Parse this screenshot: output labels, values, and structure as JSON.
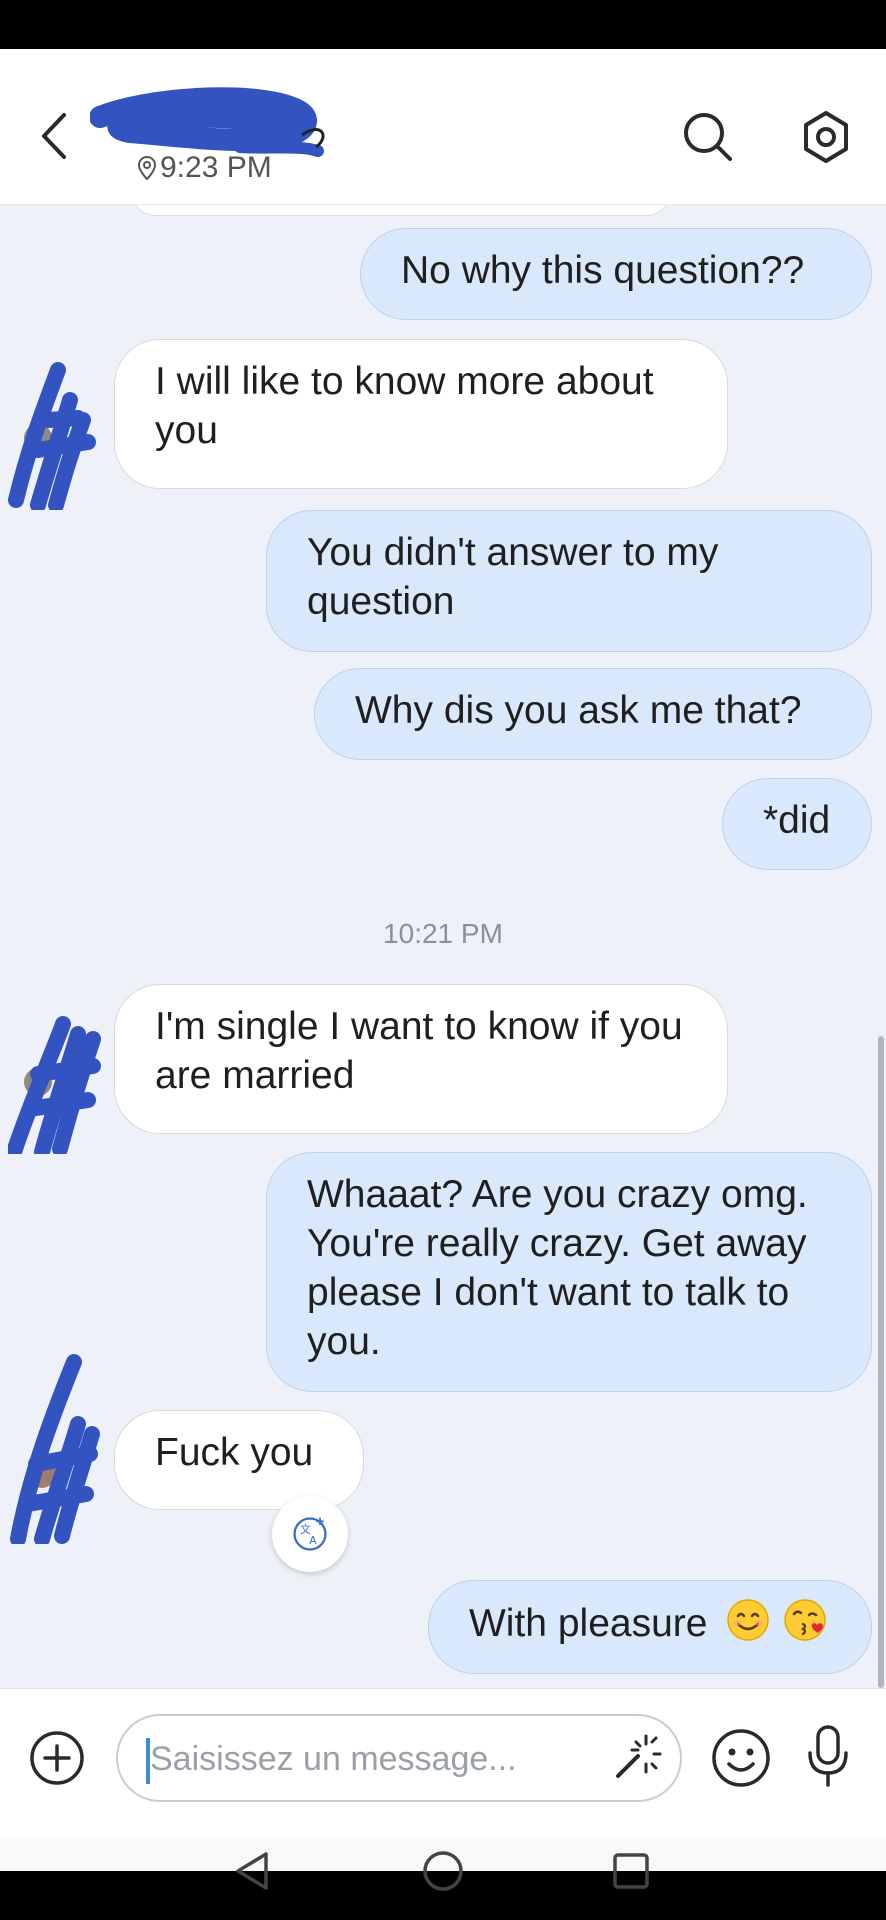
{
  "header": {
    "last_seen_time": "9:23 PM"
  },
  "messages": [
    {
      "direction": "out",
      "text": "No why this question??"
    },
    {
      "direction": "in",
      "text": "I will like to know more about you"
    },
    {
      "direction": "out",
      "text": "You didn't answer to my question"
    },
    {
      "direction": "out",
      "text": "Why dis you ask me that?"
    },
    {
      "direction": "out",
      "text": "*did"
    },
    {
      "direction": "in",
      "text": "I'm single I want to know if you are married"
    },
    {
      "direction": "out",
      "text": "Whaaat? Are you crazy omg. You're really crazy. Get away please I don't want to talk to you."
    },
    {
      "direction": "in",
      "text": "Fuck you"
    },
    {
      "direction": "out",
      "text": "With pleasure"
    }
  ],
  "time_separator": "10:21 PM",
  "composer": {
    "placeholder": "Saisissez un message..."
  },
  "icons": [
    "back-icon",
    "search-icon",
    "settings-icon",
    "translate-icon",
    "smile-emoji-icon",
    "kiss-emoji-icon",
    "plus-icon",
    "magic-wand-icon",
    "emoji-icon",
    "microphone-icon",
    "nav-back-icon",
    "nav-home-icon",
    "nav-recents-icon"
  ],
  "colors": {
    "outgoing_bubble": "#d9e8fb",
    "incoming_bubble": "#ffffff",
    "chat_background": "#eef1f7",
    "scribble": "#3354c0"
  }
}
